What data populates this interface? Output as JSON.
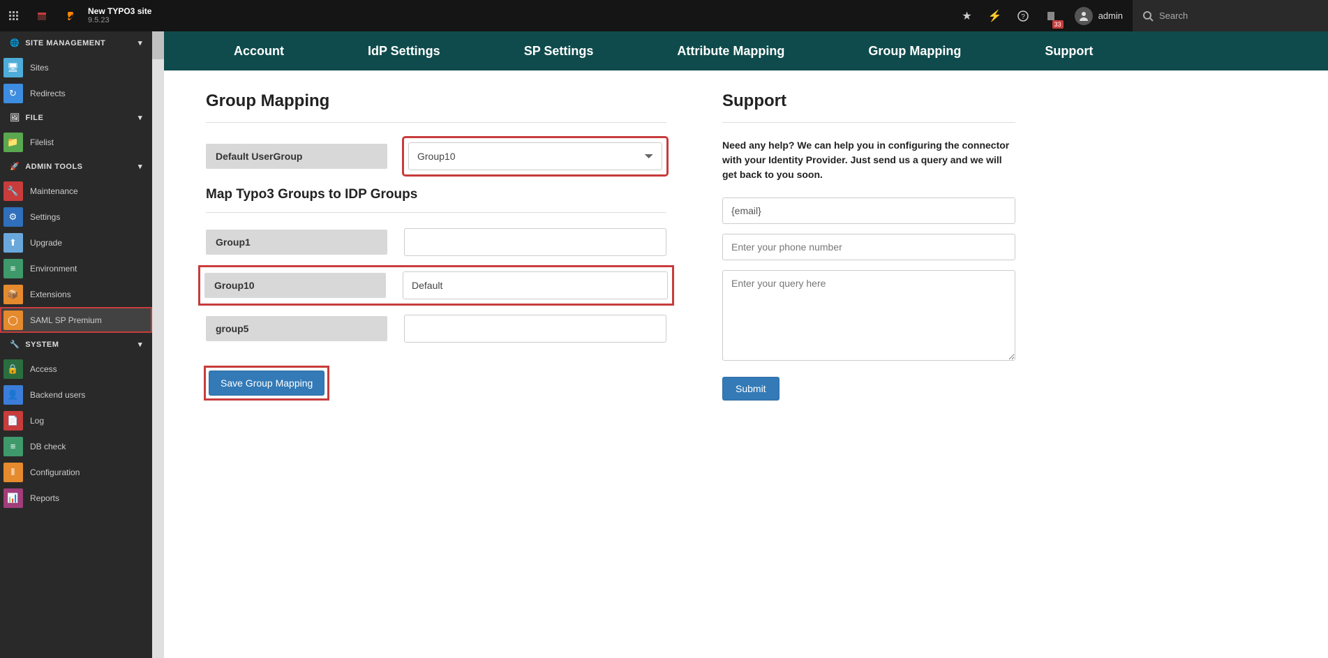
{
  "topbar": {
    "site_title": "New TYPO3 site",
    "version": "9.5.23",
    "badge": "33",
    "user": "admin",
    "search_placeholder": "Search"
  },
  "sidebar": {
    "sections": {
      "site_mgmt": "SITE MANAGEMENT",
      "file": "FILE",
      "admin": "ADMIN TOOLS",
      "system": "SYSTEM"
    },
    "items": {
      "sites": "Sites",
      "redirects": "Redirects",
      "filelist": "Filelist",
      "maintenance": "Maintenance",
      "settings": "Settings",
      "upgrade": "Upgrade",
      "environment": "Environment",
      "extensions": "Extensions",
      "samlsp": "SAML SP Premium",
      "access": "Access",
      "backendusers": "Backend users",
      "log": "Log",
      "dbcheck": "DB check",
      "configuration": "Configuration",
      "reports": "Reports"
    }
  },
  "tabs": {
    "account": "Account",
    "idp": "IdP Settings",
    "sp": "SP Settings",
    "attr": "Attribute Mapping",
    "group": "Group Mapping",
    "support": "Support"
  },
  "main": {
    "heading": "Group Mapping",
    "default_group_label": "Default UserGroup",
    "default_group_value": "Group10",
    "subheading": "Map Typo3 Groups to IDP Groups",
    "rows": [
      {
        "label": "Group1",
        "value": ""
      },
      {
        "label": "Group10",
        "value": "Default"
      },
      {
        "label": "group5",
        "value": ""
      }
    ],
    "save_button": "Save Group Mapping"
  },
  "support": {
    "heading": "Support",
    "text": "Need any help? We can help you in configuring the connector with your Identity Provider. Just send us a query and we will get back to you soon.",
    "email_value": "{email}",
    "phone_placeholder": "Enter your phone number",
    "query_placeholder": "Enter your query here",
    "submit": "Submit"
  },
  "icons": {
    "sites": {
      "bg": "#4eacd9",
      "glyph": "🖥"
    },
    "redirects": {
      "bg": "#3d8de0",
      "glyph": "↻"
    },
    "filelist": {
      "bg": "#59a84f",
      "glyph": "📁"
    },
    "maintenance": {
      "bg": "#c83c3c",
      "glyph": "🔧"
    },
    "settings": {
      "bg": "#2f6fbb",
      "glyph": "⚙"
    },
    "upgrade": {
      "bg": "#6aa8db",
      "glyph": "⬆"
    },
    "environment": {
      "bg": "#3e9a6b",
      "glyph": "≡"
    },
    "extensions": {
      "bg": "#e68a2e",
      "glyph": "📦"
    },
    "samlsp": {
      "bg": "#e68a2e",
      "glyph": "◯"
    },
    "access": {
      "bg": "#2a6e3f",
      "glyph": "🔒"
    },
    "backendusers": {
      "bg": "#3b7dd8",
      "glyph": "👤"
    },
    "log": {
      "bg": "#c83c3c",
      "glyph": "📄"
    },
    "dbcheck": {
      "bg": "#3e9a6b",
      "glyph": "≡"
    },
    "configuration": {
      "bg": "#e68a2e",
      "glyph": "⦀"
    },
    "reports": {
      "bg": "#a03d7a",
      "glyph": "📊"
    }
  }
}
